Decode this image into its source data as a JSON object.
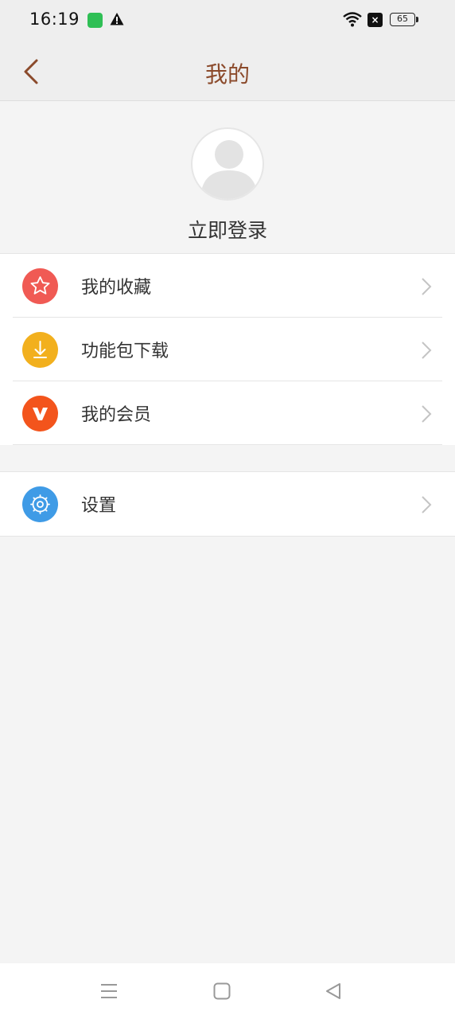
{
  "status_bar": {
    "time": "16:19",
    "battery": "65",
    "icons": [
      "app-notification-icon",
      "warning-icon",
      "wifi-icon",
      "sim-x-icon",
      "battery-icon"
    ]
  },
  "header": {
    "title": "我的",
    "back_icon": "chevron-left-icon"
  },
  "profile": {
    "login_label": "立即登录",
    "avatar_icon": "default-avatar-icon"
  },
  "menu": {
    "items": [
      {
        "label": "我的收藏",
        "icon": "star-icon",
        "color": "#f05a54"
      },
      {
        "label": "功能包下载",
        "icon": "download-icon",
        "color": "#f2b01e"
      },
      {
        "label": "我的会员",
        "icon": "vip-icon",
        "color": "#f3541c"
      }
    ],
    "settings": {
      "label": "设置",
      "icon": "gear-icon",
      "color": "#3f9be6"
    }
  },
  "colors": {
    "title": "#8b4a2b",
    "background": "#f4f4f4"
  },
  "nav": {
    "icons": [
      "menu-icon",
      "home-icon",
      "back-triangle-icon"
    ]
  }
}
